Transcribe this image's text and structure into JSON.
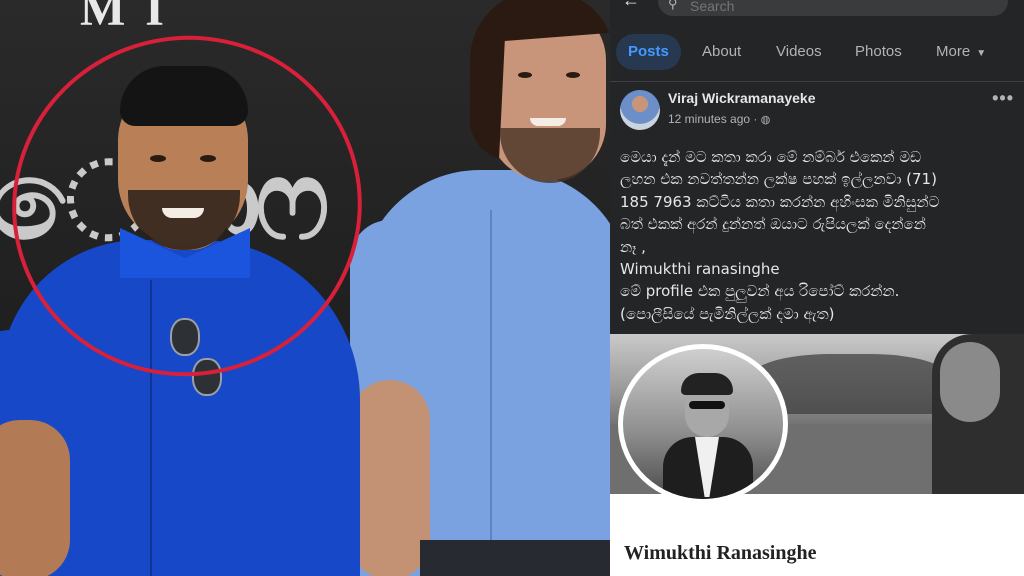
{
  "colors": {
    "fb_background": "#242526",
    "fb_accent": "#4599ff",
    "annotation_circle": "#d9203a"
  },
  "search": {
    "placeholder": "Search"
  },
  "tabs": [
    {
      "label": "Posts",
      "active": true
    },
    {
      "label": "About"
    },
    {
      "label": "Videos"
    },
    {
      "label": "Photos"
    },
    {
      "label": "More",
      "has_dropdown": true
    }
  ],
  "post": {
    "author": "Viraj Wickramanayeke",
    "time": "12 minutes ago · ",
    "privacy_icon": "globe-icon",
    "lines": [
      "මෙයා දැන් මට කතා කරා මේ නම්බර් එකෙන් මඩ",
      "ලහන එක නවත්තන්න ලක්ෂ පහක් ඉල්ලනවා (71)",
      "185 7963 කට්ටිය කතා කරන්න අහිංසක මිනිසුන්ට",
      "බත් එකක් අරන් දුන්නත්  ඔයාට රුපියලක් දෙන්නේ",
      "නෑ ,",
      "Wimukthi ranasinghe",
      "මේ profile එක පුලුවන් අය රිපෝට් කරන්න.",
      "(පොලීසියේ පැමිනිල්ලක් දමා ඇත)"
    ]
  },
  "profile": {
    "name": "Wimukthi Ranasinghe"
  },
  "photo": {
    "banner_text": "MI"
  }
}
